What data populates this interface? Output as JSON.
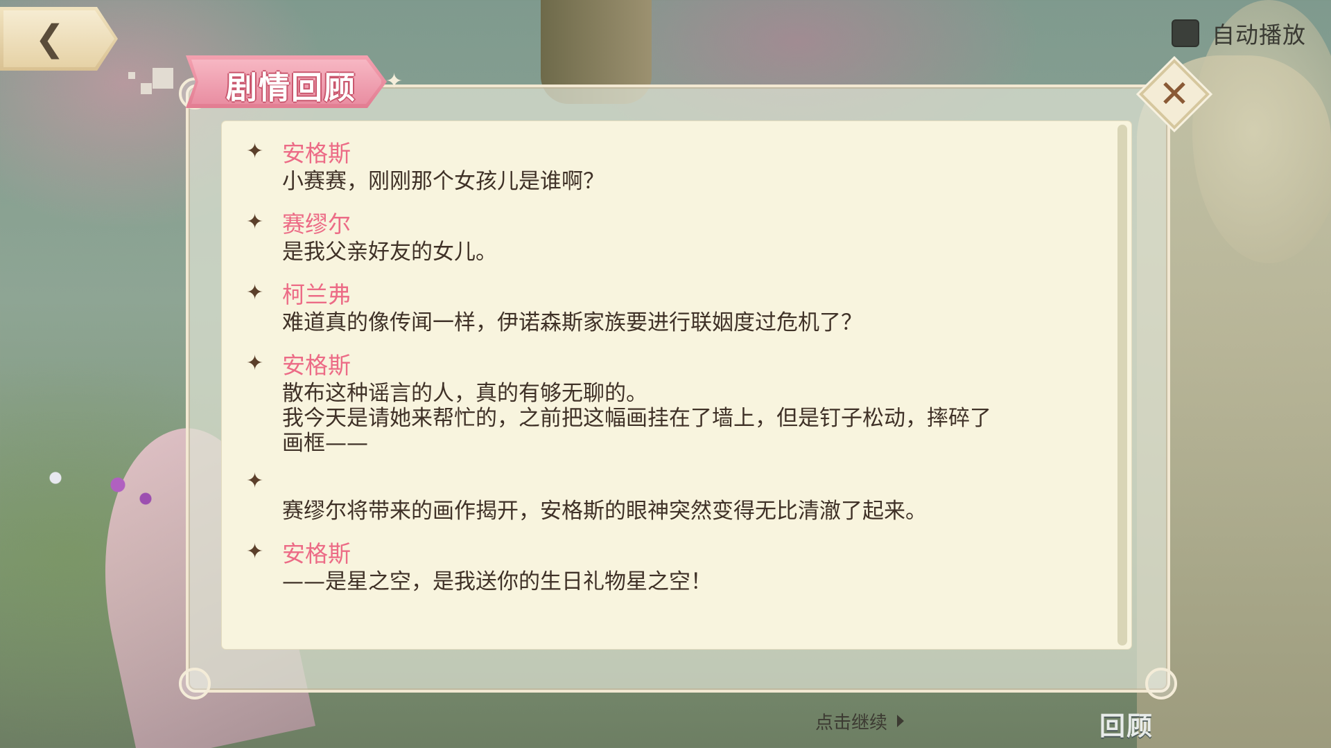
{
  "header": {
    "autoplay_label": "自动播放",
    "autoplay_checked": false
  },
  "panel": {
    "title": "剧情回顾",
    "entries": [
      {
        "speaker": "安格斯",
        "lines": [
          "小赛赛，刚刚那个女孩儿是谁啊？"
        ]
      },
      {
        "speaker": "赛缪尔",
        "lines": [
          "是我父亲好友的女儿。"
        ]
      },
      {
        "speaker": "柯兰弗",
        "lines": [
          "难道真的像传闻一样，伊诺森斯家族要进行联姻度过危机了？"
        ]
      },
      {
        "speaker": "安格斯",
        "lines": [
          "散布这种谣言的人，真的有够无聊的。",
          "我今天是请她来帮忙的，之前把这幅画挂在了墙上，但是钉子松动，摔碎了",
          "画框——"
        ]
      },
      {
        "speaker": "",
        "lines": [
          "赛缪尔将带来的画作揭开，安格斯的眼神突然变得无比清澈了起来。"
        ]
      },
      {
        "speaker": "安格斯",
        "lines": [
          "——是星之空，是我送你的生日礼物星之空！"
        ]
      }
    ]
  },
  "footer": {
    "continue_label": "点击继续",
    "review_label": "回顾"
  },
  "colors": {
    "speaker": "#ec6b86",
    "dialogue_text": "#3f3127",
    "title_tab": "#e27d92",
    "panel_bg": "#f8f4de"
  },
  "icons": {
    "back": "back-arrow-icon",
    "close": "close-icon",
    "entry_marker": "sparkle-star-icon"
  }
}
